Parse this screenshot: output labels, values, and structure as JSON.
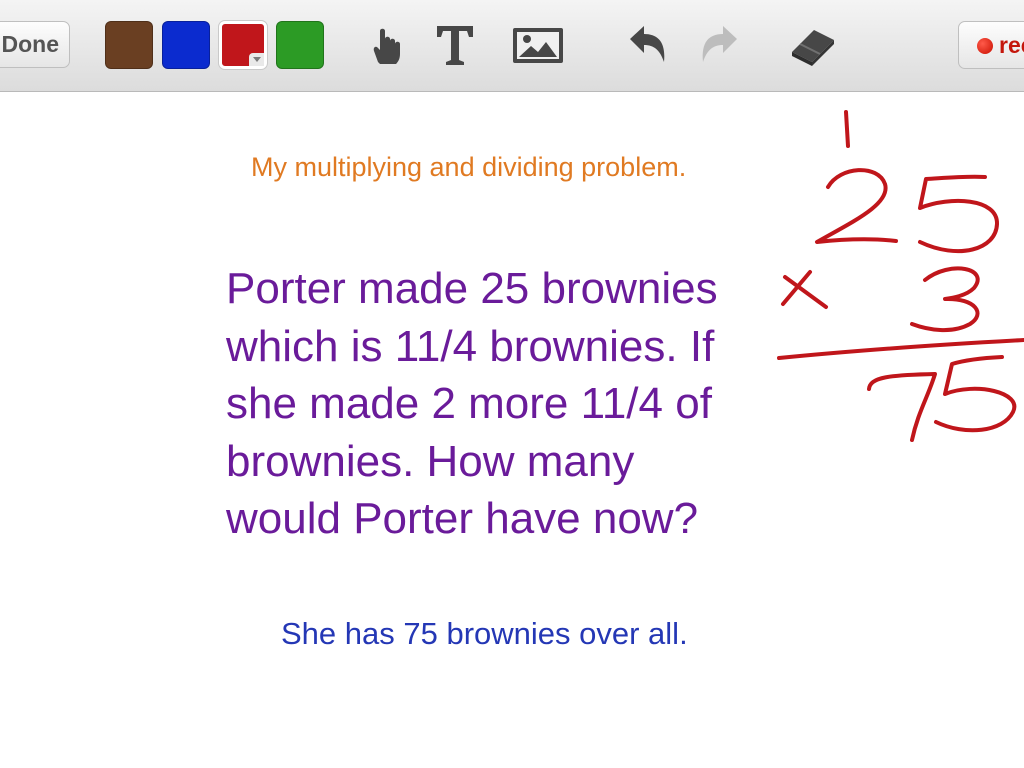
{
  "toolbar": {
    "done_label": "Done",
    "colors": [
      {
        "name": "brown",
        "hex": "#6a3f22",
        "selected": false
      },
      {
        "name": "blue",
        "hex": "#0b2bcf",
        "selected": false
      },
      {
        "name": "red",
        "hex": "#c0161b",
        "selected": true
      },
      {
        "name": "green",
        "hex": "#2c9b25",
        "selected": false
      }
    ],
    "tools": [
      "hand-pointer-icon",
      "text-tool-icon",
      "image-icon",
      "undo-icon",
      "redo-icon",
      "eraser-icon"
    ],
    "record_label": "rec"
  },
  "canvas": {
    "subtitle": "My multiplying and dividing problem.",
    "problem_lines": [
      "Porter made 25 brownies",
      "which is 11/4 brownies. If",
      "she made 2 more 11/4 of",
      "brownies. How many",
      "would Porter have now?"
    ],
    "answer": "She has 75 brownies over all.",
    "colors": {
      "subtitle": "#e07a22",
      "problem": "#6a1b9a",
      "answer": "#2437b5",
      "ink": "#c0161b"
    },
    "handwriting": {
      "carry": "1",
      "top_number": "25",
      "operator": "x",
      "multiplier": "3",
      "result": "75"
    }
  }
}
